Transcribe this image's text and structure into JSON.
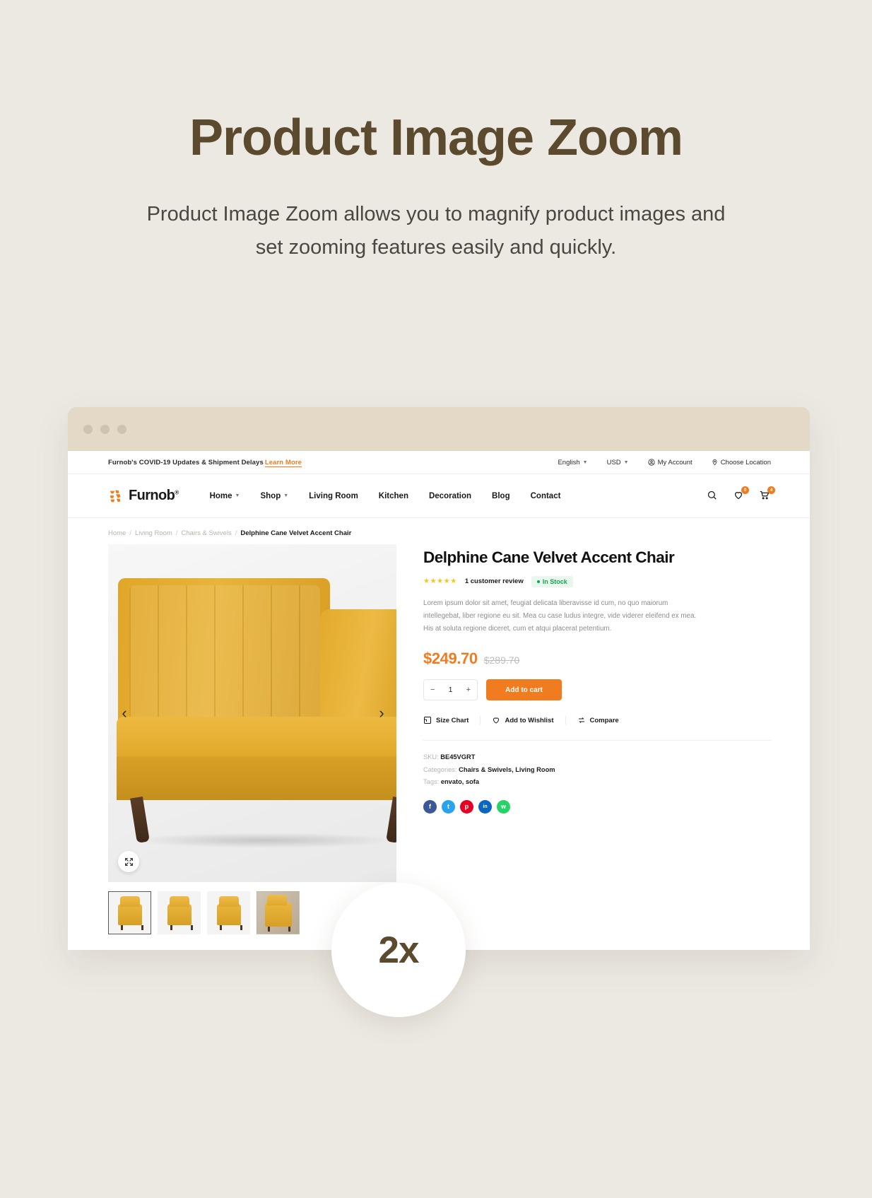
{
  "hero": {
    "title": "Product Image Zoom",
    "subtitle": "Product Image Zoom allows you to magnify product images and set zooming features easily and quickly."
  },
  "browser": {
    "dots": 3
  },
  "topbar": {
    "notice": "Furnob's COVID-19 Updates & Shipment Delays",
    "learn_more": "Learn More",
    "language": "English",
    "currency": "USD",
    "account": "My Account",
    "location": "Choose Location"
  },
  "nav": {
    "logo_text": "Furnob",
    "logo_registered": "®",
    "menu": [
      {
        "label": "Home",
        "has_caret": true
      },
      {
        "label": "Shop",
        "has_caret": true
      },
      {
        "label": "Living Room",
        "has_caret": false
      },
      {
        "label": "Kitchen",
        "has_caret": false
      },
      {
        "label": "Decoration",
        "has_caret": false
      },
      {
        "label": "Blog",
        "has_caret": false
      },
      {
        "label": "Contact",
        "has_caret": false
      }
    ],
    "wishlist_count": "0",
    "cart_count": "4"
  },
  "breadcrumb": {
    "items": [
      "Home",
      "Living Room",
      "Chairs & Swivels"
    ],
    "current": "Delphine Cane Velvet Accent Chair",
    "separator": "/"
  },
  "product": {
    "title": "Delphine Cane Velvet Accent Chair",
    "stars": "★★★★★",
    "review_text": "1 customer review",
    "stock": "In Stock",
    "description": "Lorem ipsum dolor sit amet, feugiat delicata liberavisse id cum, no quo maiorum intellegebat, liber regione eu sit. Mea cu case ludus integre, vide viderer eleifend ex mea. His at soluta regione diceret, cum et atqui placerat petentium.",
    "price_new": "$249.70",
    "price_old": "$289.70",
    "quantity": "1",
    "qty_minus": "−",
    "qty_plus": "+",
    "add_to_cart": "Add to cart",
    "actions": [
      "Size Chart",
      "Add to Wishlist",
      "Compare"
    ],
    "sku_label": "SKU:",
    "sku_value": "BE45VGRT",
    "categories_label": "Categories:",
    "categories_value": "Chairs & Swivels, Living Room",
    "tags_label": "Tags:",
    "tags_value": "envato, sofa",
    "socials": [
      {
        "name": "facebook",
        "glyph": "f",
        "color": "#3b5998"
      },
      {
        "name": "twitter",
        "glyph": "t",
        "color": "#2aa3ef"
      },
      {
        "name": "pinterest",
        "glyph": "p",
        "color": "#e60023"
      },
      {
        "name": "linkedin",
        "glyph": "in",
        "color": "#0a66c2"
      },
      {
        "name": "whatsapp",
        "glyph": "w",
        "color": "#25d366"
      }
    ],
    "prev_arrow": "‹",
    "next_arrow": "›",
    "thumbnails": [
      "thumb-front",
      "thumb-angle",
      "thumb-side",
      "thumb-lifestyle"
    ]
  },
  "zoom_badge": {
    "label": "2x"
  },
  "colors": {
    "accent": "#f07c1f",
    "title_brown": "#5c4a2e",
    "page_bg": "#ece9e3",
    "stock_green": "#17a34a"
  }
}
